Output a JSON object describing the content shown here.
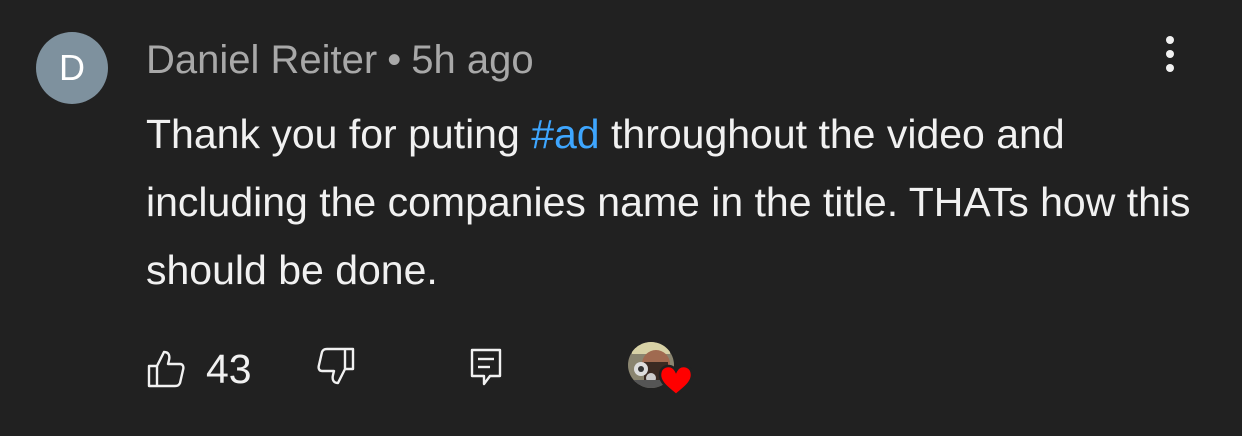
{
  "comment": {
    "avatar_letter": "D",
    "author": "Daniel Reiter",
    "separator": "•",
    "time": "5h ago",
    "text_before": "Thank you for puting ",
    "hashtag": "#ad",
    "text_after": " throughout the video and including the companies name in the title. THATs how this should be done.",
    "like_count": "43"
  },
  "icons": {
    "more": "more-vert-icon",
    "like": "thumbs-up-icon",
    "dislike": "thumbs-down-icon",
    "reply": "reply-icon",
    "heart": "creator-heart-icon"
  },
  "colors": {
    "background": "#212121",
    "avatar": "#7e919e",
    "meta_text": "#a8a8a8",
    "body_text": "#f1f1f1",
    "hashtag": "#3ea6ff",
    "heart": "#ff0000"
  }
}
